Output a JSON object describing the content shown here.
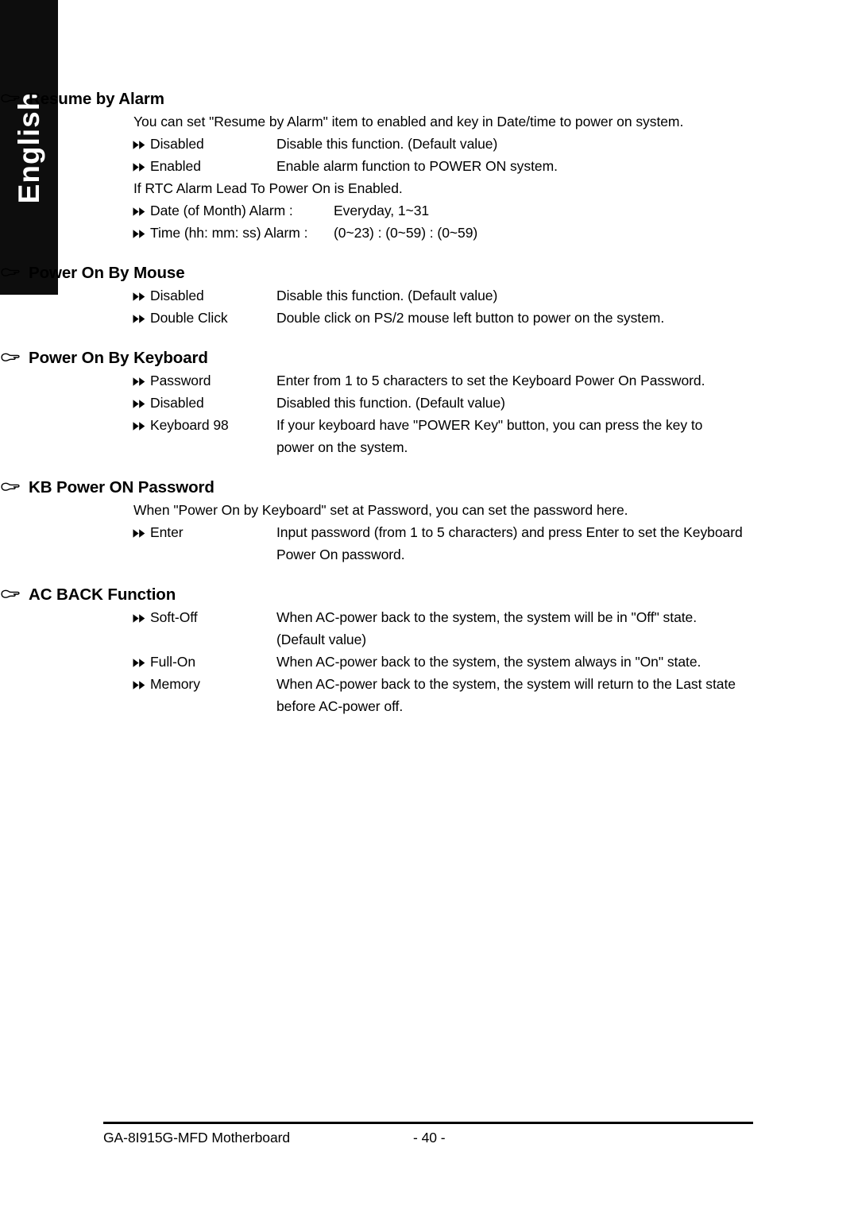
{
  "sidebar": {
    "language_label": "English"
  },
  "icons": {
    "heading_bullet": "pointing-hand-icon",
    "option_bullet": "double-triangle-right-icon"
  },
  "page": {
    "sections": [
      {
        "id": "resume-by-alarm",
        "title": "Resume by Alarm",
        "paragraphs": [
          {
            "after_index": -1,
            "text": "You can set \"Resume by Alarm\" item to enabled and key in Date/time to power on system."
          },
          {
            "after_index": 1,
            "text": "If RTC Alarm Lead To Power On is Enabled."
          }
        ],
        "options": [
          {
            "label": "Disabled",
            "desc": "Disable this function. (Default value)",
            "desc2": ""
          },
          {
            "label": "Enabled",
            "desc": "Enable alarm function to POWER ON system.",
            "desc2": ""
          },
          {
            "label": "Date (of Month) Alarm :",
            "desc": "Everyday, 1~31",
            "desc2": "",
            "wide": true
          },
          {
            "label": "Time (hh: mm: ss) Alarm :",
            "desc": "(0~23) : (0~59) : (0~59)",
            "desc2": "",
            "wide": true
          }
        ]
      },
      {
        "id": "power-on-by-mouse",
        "title": "Power On By Mouse",
        "paragraphs": [],
        "options": [
          {
            "label": "Disabled",
            "desc": "Disable this function. (Default value)",
            "desc2": ""
          },
          {
            "label": "Double Click",
            "desc": "Double click on PS/2 mouse left button to power on the system.",
            "desc2": ""
          }
        ]
      },
      {
        "id": "power-on-by-keyboard",
        "title": "Power On By Keyboard",
        "paragraphs": [],
        "options": [
          {
            "label": "Password",
            "desc": "Enter from 1 to 5 characters to set the Keyboard Power On Password.",
            "desc2": ""
          },
          {
            "label": "Disabled",
            "desc": "Disabled this function. (Default value)",
            "desc2": ""
          },
          {
            "label": "Keyboard 98",
            "desc": "If your keyboard have \"POWER Key\" button, you can press the key to",
            "desc2": "power on the system."
          }
        ]
      },
      {
        "id": "kb-power-on-password",
        "title": "KB Power ON Password",
        "paragraphs": [
          {
            "after_index": -1,
            "text": "When \"Power On by Keyboard\" set at Password, you can set the password here."
          }
        ],
        "options": [
          {
            "label": "Enter",
            "desc": "Input password (from 1 to 5 characters) and press Enter to set the Keyboard",
            "desc2": "Power On password."
          }
        ]
      },
      {
        "id": "ac-back-function",
        "title": "AC BACK Function",
        "paragraphs": [],
        "options": [
          {
            "label": "Soft-Off",
            "desc": "When AC-power back to the system, the system will be in \"Off\" state.",
            "desc2": "(Default value)"
          },
          {
            "label": "Full-On",
            "desc": "When AC-power back to the system, the system always in \"On\" state.",
            "desc2": ""
          },
          {
            "label": "Memory",
            "desc": "When AC-power back to the system, the system will return to the Last state",
            "desc2": "before AC-power off."
          }
        ]
      }
    ]
  },
  "footer": {
    "left_text": "GA-8I915G-MFD Motherboard",
    "page_number": "- 40 -"
  },
  "colors": {
    "tab_background": "#0d0d0d",
    "tab_text": "#ffffff",
    "body_text": "#000000",
    "page_background": "#ffffff"
  }
}
